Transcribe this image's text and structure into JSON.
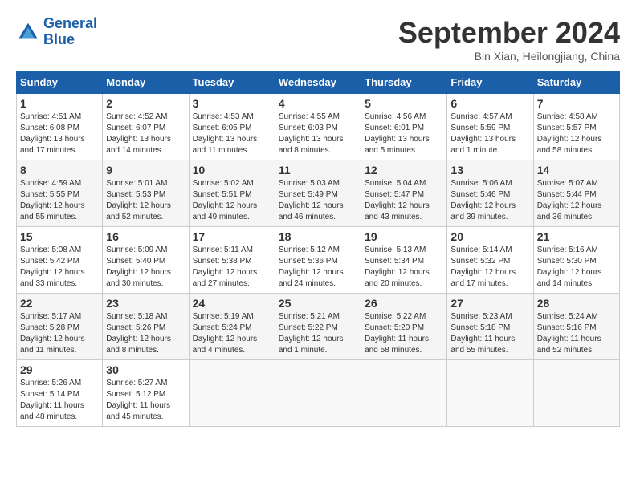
{
  "logo": {
    "line1": "General",
    "line2": "Blue"
  },
  "title": "September 2024",
  "subtitle": "Bin Xian, Heilongjiang, China",
  "days_header": [
    "Sunday",
    "Monday",
    "Tuesday",
    "Wednesday",
    "Thursday",
    "Friday",
    "Saturday"
  ],
  "weeks": [
    [
      {
        "day": "1",
        "info": "Sunrise: 4:51 AM\nSunset: 6:08 PM\nDaylight: 13 hours\nand 17 minutes."
      },
      {
        "day": "2",
        "info": "Sunrise: 4:52 AM\nSunset: 6:07 PM\nDaylight: 13 hours\nand 14 minutes."
      },
      {
        "day": "3",
        "info": "Sunrise: 4:53 AM\nSunset: 6:05 PM\nDaylight: 13 hours\nand 11 minutes."
      },
      {
        "day": "4",
        "info": "Sunrise: 4:55 AM\nSunset: 6:03 PM\nDaylight: 13 hours\nand 8 minutes."
      },
      {
        "day": "5",
        "info": "Sunrise: 4:56 AM\nSunset: 6:01 PM\nDaylight: 13 hours\nand 5 minutes."
      },
      {
        "day": "6",
        "info": "Sunrise: 4:57 AM\nSunset: 5:59 PM\nDaylight: 13 hours\nand 1 minute."
      },
      {
        "day": "7",
        "info": "Sunrise: 4:58 AM\nSunset: 5:57 PM\nDaylight: 12 hours\nand 58 minutes."
      }
    ],
    [
      {
        "day": "8",
        "info": "Sunrise: 4:59 AM\nSunset: 5:55 PM\nDaylight: 12 hours\nand 55 minutes."
      },
      {
        "day": "9",
        "info": "Sunrise: 5:01 AM\nSunset: 5:53 PM\nDaylight: 12 hours\nand 52 minutes."
      },
      {
        "day": "10",
        "info": "Sunrise: 5:02 AM\nSunset: 5:51 PM\nDaylight: 12 hours\nand 49 minutes."
      },
      {
        "day": "11",
        "info": "Sunrise: 5:03 AM\nSunset: 5:49 PM\nDaylight: 12 hours\nand 46 minutes."
      },
      {
        "day": "12",
        "info": "Sunrise: 5:04 AM\nSunset: 5:47 PM\nDaylight: 12 hours\nand 43 minutes."
      },
      {
        "day": "13",
        "info": "Sunrise: 5:06 AM\nSunset: 5:46 PM\nDaylight: 12 hours\nand 39 minutes."
      },
      {
        "day": "14",
        "info": "Sunrise: 5:07 AM\nSunset: 5:44 PM\nDaylight: 12 hours\nand 36 minutes."
      }
    ],
    [
      {
        "day": "15",
        "info": "Sunrise: 5:08 AM\nSunset: 5:42 PM\nDaylight: 12 hours\nand 33 minutes."
      },
      {
        "day": "16",
        "info": "Sunrise: 5:09 AM\nSunset: 5:40 PM\nDaylight: 12 hours\nand 30 minutes."
      },
      {
        "day": "17",
        "info": "Sunrise: 5:11 AM\nSunset: 5:38 PM\nDaylight: 12 hours\nand 27 minutes."
      },
      {
        "day": "18",
        "info": "Sunrise: 5:12 AM\nSunset: 5:36 PM\nDaylight: 12 hours\nand 24 minutes."
      },
      {
        "day": "19",
        "info": "Sunrise: 5:13 AM\nSunset: 5:34 PM\nDaylight: 12 hours\nand 20 minutes."
      },
      {
        "day": "20",
        "info": "Sunrise: 5:14 AM\nSunset: 5:32 PM\nDaylight: 12 hours\nand 17 minutes."
      },
      {
        "day": "21",
        "info": "Sunrise: 5:16 AM\nSunset: 5:30 PM\nDaylight: 12 hours\nand 14 minutes."
      }
    ],
    [
      {
        "day": "22",
        "info": "Sunrise: 5:17 AM\nSunset: 5:28 PM\nDaylight: 12 hours\nand 11 minutes."
      },
      {
        "day": "23",
        "info": "Sunrise: 5:18 AM\nSunset: 5:26 PM\nDaylight: 12 hours\nand 8 minutes."
      },
      {
        "day": "24",
        "info": "Sunrise: 5:19 AM\nSunset: 5:24 PM\nDaylight: 12 hours\nand 4 minutes."
      },
      {
        "day": "25",
        "info": "Sunrise: 5:21 AM\nSunset: 5:22 PM\nDaylight: 12 hours\nand 1 minute."
      },
      {
        "day": "26",
        "info": "Sunrise: 5:22 AM\nSunset: 5:20 PM\nDaylight: 11 hours\nand 58 minutes."
      },
      {
        "day": "27",
        "info": "Sunrise: 5:23 AM\nSunset: 5:18 PM\nDaylight: 11 hours\nand 55 minutes."
      },
      {
        "day": "28",
        "info": "Sunrise: 5:24 AM\nSunset: 5:16 PM\nDaylight: 11 hours\nand 52 minutes."
      }
    ],
    [
      {
        "day": "29",
        "info": "Sunrise: 5:26 AM\nSunset: 5:14 PM\nDaylight: 11 hours\nand 48 minutes."
      },
      {
        "day": "30",
        "info": "Sunrise: 5:27 AM\nSunset: 5:12 PM\nDaylight: 11 hours\nand 45 minutes."
      },
      {
        "day": "",
        "info": ""
      },
      {
        "day": "",
        "info": ""
      },
      {
        "day": "",
        "info": ""
      },
      {
        "day": "",
        "info": ""
      },
      {
        "day": "",
        "info": ""
      }
    ]
  ]
}
